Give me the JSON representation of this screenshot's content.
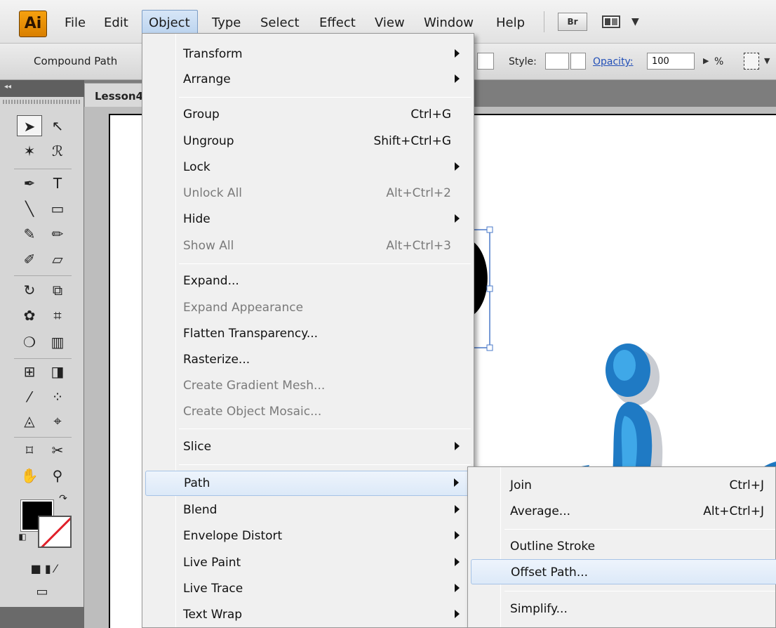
{
  "app": {
    "logo": "Ai",
    "accent_color": "#e98c00",
    "menus": [
      "File",
      "Edit",
      "Object",
      "Type",
      "Select",
      "Effect",
      "View",
      "Window",
      "Help"
    ],
    "active_menu": "Object",
    "bridge_label": "Br"
  },
  "control_bar": {
    "selection_type": "Compound Path",
    "style_label": "Style:",
    "opacity_label": "Opacity:",
    "opacity_value": "100",
    "percent": "%"
  },
  "document": {
    "tab_label": "Lesson4"
  },
  "object_menu": {
    "items": [
      {
        "label": "Transform",
        "shortcut": "",
        "submenu": true,
        "enabled": true
      },
      {
        "label": "Arrange",
        "shortcut": "",
        "submenu": true,
        "enabled": true
      },
      {
        "label": "Group",
        "shortcut": "Ctrl+G",
        "submenu": false,
        "enabled": true
      },
      {
        "label": "Ungroup",
        "shortcut": "Shift+Ctrl+G",
        "submenu": false,
        "enabled": true
      },
      {
        "label": "Lock",
        "shortcut": "",
        "submenu": true,
        "enabled": true
      },
      {
        "label": "Unlock All",
        "shortcut": "Alt+Ctrl+2",
        "submenu": false,
        "enabled": false
      },
      {
        "label": "Hide",
        "shortcut": "",
        "submenu": true,
        "enabled": true
      },
      {
        "label": "Show All",
        "shortcut": "Alt+Ctrl+3",
        "submenu": false,
        "enabled": false
      },
      {
        "label": "Expand...",
        "shortcut": "",
        "submenu": false,
        "enabled": true
      },
      {
        "label": "Expand Appearance",
        "shortcut": "",
        "submenu": false,
        "enabled": false
      },
      {
        "label": "Flatten Transparency...",
        "shortcut": "",
        "submenu": false,
        "enabled": true
      },
      {
        "label": "Rasterize...",
        "shortcut": "",
        "submenu": false,
        "enabled": true
      },
      {
        "label": "Create Gradient Mesh...",
        "shortcut": "",
        "submenu": false,
        "enabled": false
      },
      {
        "label": "Create Object Mosaic...",
        "shortcut": "",
        "submenu": false,
        "enabled": false
      },
      {
        "label": "Slice",
        "shortcut": "",
        "submenu": true,
        "enabled": true
      },
      {
        "label": "Path",
        "shortcut": "",
        "submenu": true,
        "enabled": true,
        "highlighted": true
      },
      {
        "label": "Blend",
        "shortcut": "",
        "submenu": true,
        "enabled": true
      },
      {
        "label": "Envelope Distort",
        "shortcut": "",
        "submenu": true,
        "enabled": true
      },
      {
        "label": "Live Paint",
        "shortcut": "",
        "submenu": true,
        "enabled": true
      },
      {
        "label": "Live Trace",
        "shortcut": "",
        "submenu": true,
        "enabled": true
      },
      {
        "label": "Text Wrap",
        "shortcut": "",
        "submenu": true,
        "enabled": true
      }
    ]
  },
  "path_submenu": {
    "items": [
      {
        "label": "Join",
        "shortcut": "Ctrl+J"
      },
      {
        "label": "Average...",
        "shortcut": "Alt+Ctrl+J"
      },
      {
        "label": "Outline Stroke",
        "shortcut": ""
      },
      {
        "label": "Offset Path...",
        "shortcut": "",
        "highlighted": true
      },
      {
        "label": "Simplify...",
        "shortcut": ""
      }
    ]
  },
  "colors": {
    "menu_highlight": "#dce9f8",
    "artwork_blue": "#1f7ac4",
    "artwork_light_blue": "#3fa8e8"
  }
}
